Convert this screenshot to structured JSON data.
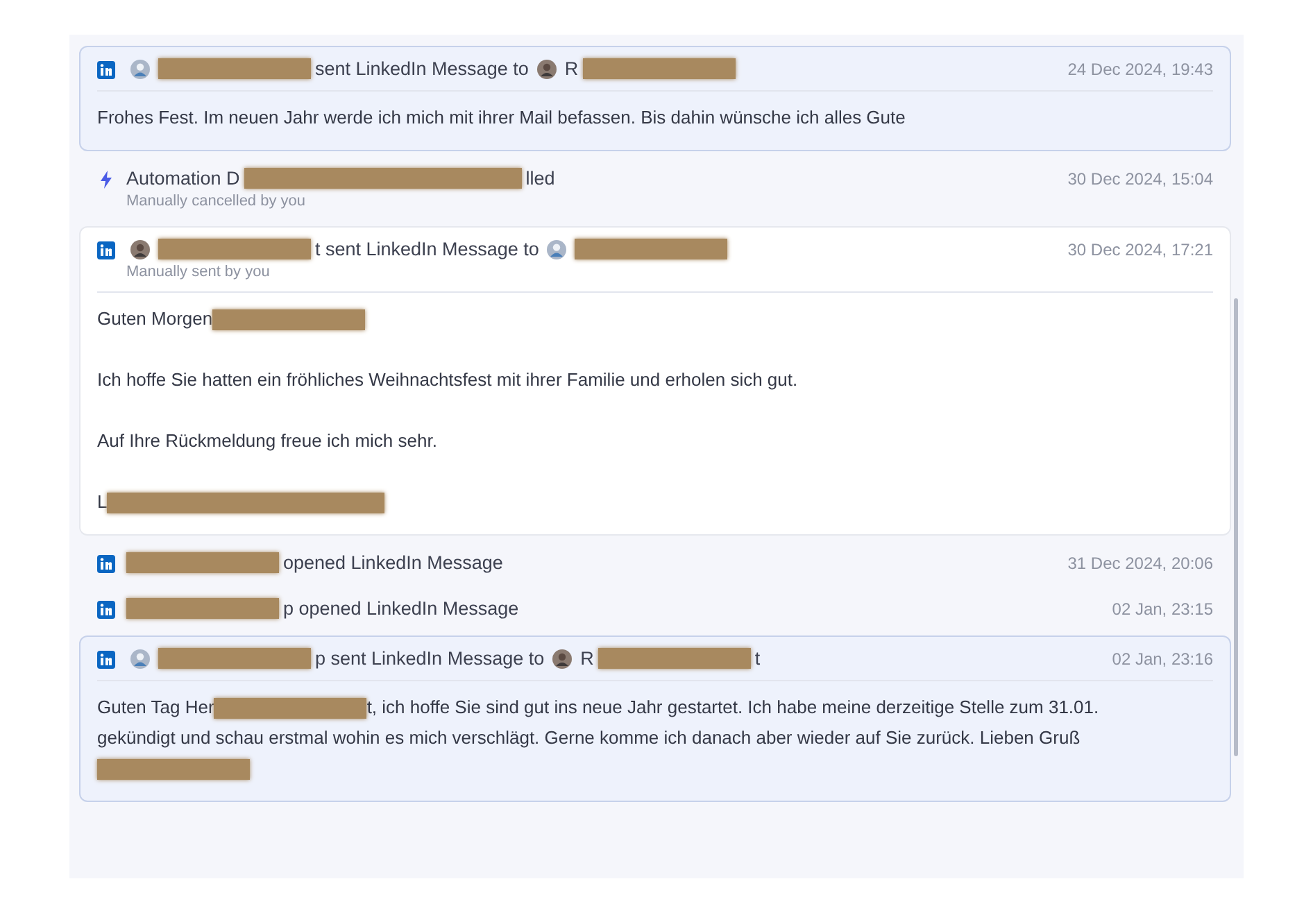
{
  "events": [
    {
      "kind": "incoming_message",
      "header": [
        {
          "kind": "contact_avatar"
        },
        {
          "kind": "redacted_name"
        },
        {
          "kind": "text",
          "text": "sent LinkedIn Message to"
        },
        {
          "kind": "photo_avatar"
        },
        {
          "kind": "text",
          "text": "R"
        },
        {
          "kind": "redacted_name"
        }
      ],
      "time": "24 Dec 2024, 19:43",
      "body": [
        [
          [
            {
              "kind": "text",
              "text": "Frohes Fest. Im neuen Jahr werde ich mich mit ihrer Mail befassen. Bis dahin wünsche ich alles Gute"
            }
          ]
        ]
      ]
    },
    {
      "kind": "automation",
      "header": [
        {
          "kind": "text",
          "text": "Automation D"
        },
        {
          "kind": "redacted_long"
        },
        {
          "kind": "text",
          "text": "lled"
        }
      ],
      "subtitle": "Manually cancelled by you",
      "time": "30 Dec 2024, 15:04"
    },
    {
      "kind": "outgoing_message",
      "header": [
        {
          "kind": "photo_avatar"
        },
        {
          "kind": "redacted_name"
        },
        {
          "kind": "text",
          "text": "t sent LinkedIn Message to"
        },
        {
          "kind": "contact_avatar"
        },
        {
          "kind": "redacted_name"
        }
      ],
      "subtitle": "Manually sent by you",
      "time": "30 Dec 2024, 17:21",
      "body": [
        [
          [
            {
              "kind": "text",
              "text": "Guten Morgen"
            },
            {
              "kind": "redacted_name"
            }
          ]
        ],
        [
          [
            {
              "kind": "text",
              "text": "Ich hoffe Sie hatten ein fröhliches Weihnachtsfest mit ihrer Familie und erholen sich gut."
            }
          ]
        ],
        [
          [
            {
              "kind": "text",
              "text": "Auf Ihre Rückmeldung freue ich mich sehr."
            }
          ]
        ],
        [
          [
            {
              "kind": "text",
              "text": "L"
            },
            {
              "kind": "redacted_long"
            }
          ]
        ]
      ]
    },
    {
      "kind": "opened",
      "header": [
        {
          "kind": "redacted_name"
        },
        {
          "kind": "text",
          "text": "opened LinkedIn Message"
        }
      ],
      "time": "31 Dec 2024, 20:06"
    },
    {
      "kind": "opened",
      "header": [
        {
          "kind": "redacted_name"
        },
        {
          "kind": "text",
          "text": "p opened LinkedIn Message"
        }
      ],
      "time": "02 Jan, 23:15"
    },
    {
      "kind": "incoming_message",
      "header": [
        {
          "kind": "contact_avatar"
        },
        {
          "kind": "redacted_name"
        },
        {
          "kind": "text",
          "text": "p sent LinkedIn Message to"
        },
        {
          "kind": "photo_avatar"
        },
        {
          "kind": "text",
          "text": "R"
        },
        {
          "kind": "redacted_name"
        },
        {
          "kind": "text",
          "text": "t"
        }
      ],
      "time": "02 Jan, 23:16",
      "body": [
        [
          [
            {
              "kind": "text",
              "text": "Guten Tag Her"
            },
            {
              "kind": "redacted_name"
            },
            {
              "kind": "text",
              "text": "t, ich hoffe Sie sind gut ins neue Jahr gestartet. Ich habe meine derzeitige Stelle zum 31.01."
            }
          ],
          [
            {
              "kind": "text",
              "text": "gekündigt und schau erstmal wohin es mich verschlägt. Gerne komme ich danach aber wieder auf Sie zurück. Lieben Gruß"
            }
          ],
          [
            {
              "kind": "redacted_name"
            }
          ]
        ]
      ]
    }
  ]
}
